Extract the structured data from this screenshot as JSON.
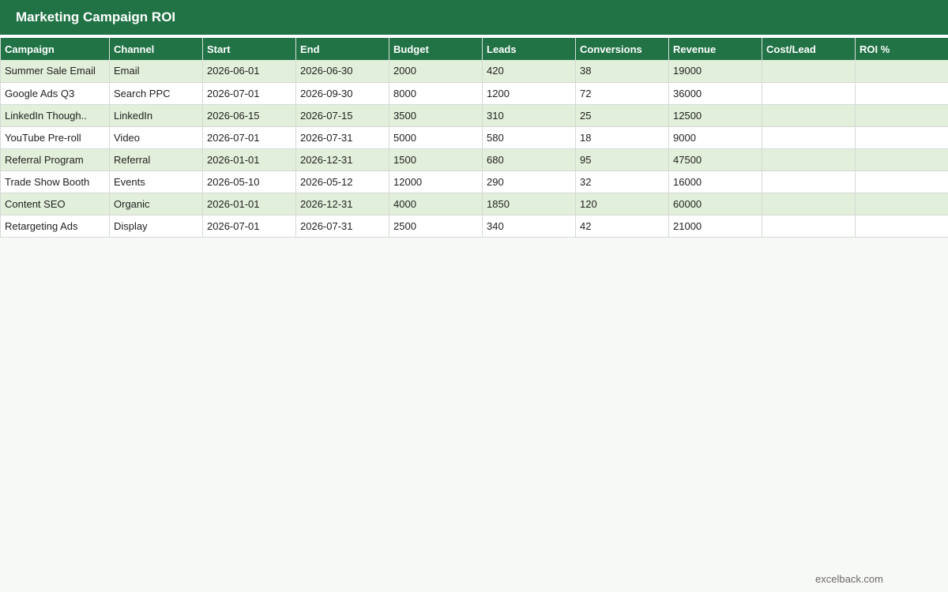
{
  "title": "Marketing Campaign ROI",
  "columns": [
    "Campaign",
    "Channel",
    "Start",
    "End",
    "Budget",
    "Leads",
    "Conversions",
    "Revenue",
    "Cost/Lead",
    "ROI %"
  ],
  "rows": [
    [
      "Summer Sale Email",
      "Email",
      "2026-06-01",
      "2026-06-30",
      "2000",
      "420",
      "38",
      "19000",
      "",
      ""
    ],
    [
      "Google Ads Q3",
      "Search PPC",
      "2026-07-01",
      "2026-09-30",
      "8000",
      "1200",
      "72",
      "36000",
      "",
      ""
    ],
    [
      "LinkedIn Though..",
      "LinkedIn",
      "2026-06-15",
      "2026-07-15",
      "3500",
      "310",
      "25",
      "12500",
      "",
      ""
    ],
    [
      "YouTube Pre-roll",
      "Video",
      "2026-07-01",
      "2026-07-31",
      "5000",
      "580",
      "18",
      "9000",
      "",
      ""
    ],
    [
      "Referral Program",
      "Referral",
      "2026-01-01",
      "2026-12-31",
      "1500",
      "680",
      "95",
      "47500",
      "",
      ""
    ],
    [
      "Trade Show Booth",
      "Events",
      "2026-05-10",
      "2026-05-12",
      "12000",
      "290",
      "32",
      "16000",
      "",
      ""
    ],
    [
      "Content SEO",
      "Organic",
      "2026-01-01",
      "2026-12-31",
      "4000",
      "1850",
      "120",
      "60000",
      "",
      ""
    ],
    [
      "Retargeting Ads",
      "Display",
      "2026-07-01",
      "2026-07-31",
      "2500",
      "340",
      "42",
      "21000",
      "",
      ""
    ]
  ],
  "footer": {
    "brand": "excelback.com"
  },
  "colors": {
    "header_green": "#217346",
    "band_green": "#e2efda",
    "page_background": "#f7f9f6"
  }
}
